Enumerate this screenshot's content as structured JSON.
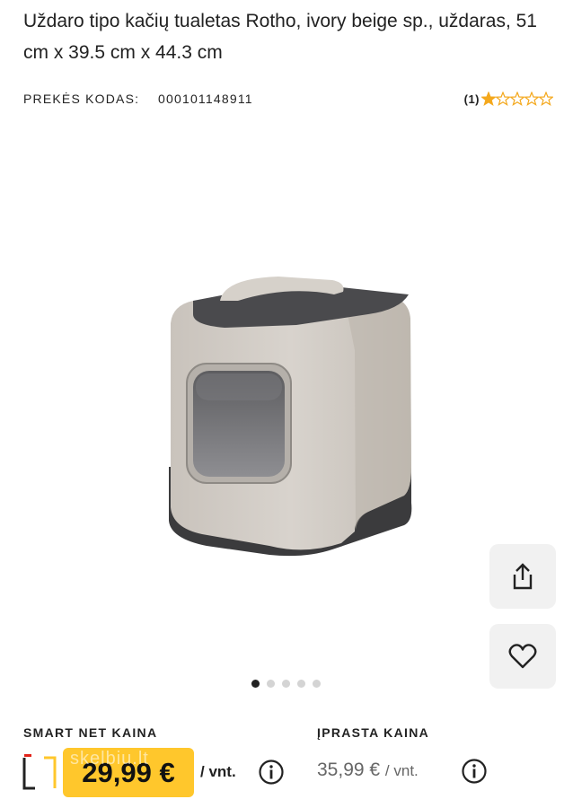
{
  "product": {
    "title": "Uždaro tipo kačių tualetas Rotho, ivory beige sp., uždaras, 51 cm x 39.5 cm x 44.3 cm",
    "code_label": "PREKĖS KODAS:",
    "code_value": "000101148911",
    "rating_count": "(1)",
    "rating_value": 1,
    "rating_max": 5
  },
  "gallery": {
    "total_slides": 5,
    "active_slide": 1,
    "image_name": "closed cat litter box"
  },
  "actions": {
    "share_icon": "share-icon",
    "favorite_icon": "heart-icon"
  },
  "pricing": {
    "smart_label": "SMART NET KAINA",
    "smart_price": "29,99 €",
    "smart_unit": "/ vnt.",
    "regular_label": "ĮPRASTA KAINA",
    "regular_price": "35,99 €",
    "regular_unit": "/ vnt.",
    "info_icon": "info-icon",
    "watermark": "skelbiu.lt"
  },
  "colors": {
    "accent": "#ffc72c",
    "star": "#f4a81d",
    "button_bg": "#f1f1f1"
  }
}
